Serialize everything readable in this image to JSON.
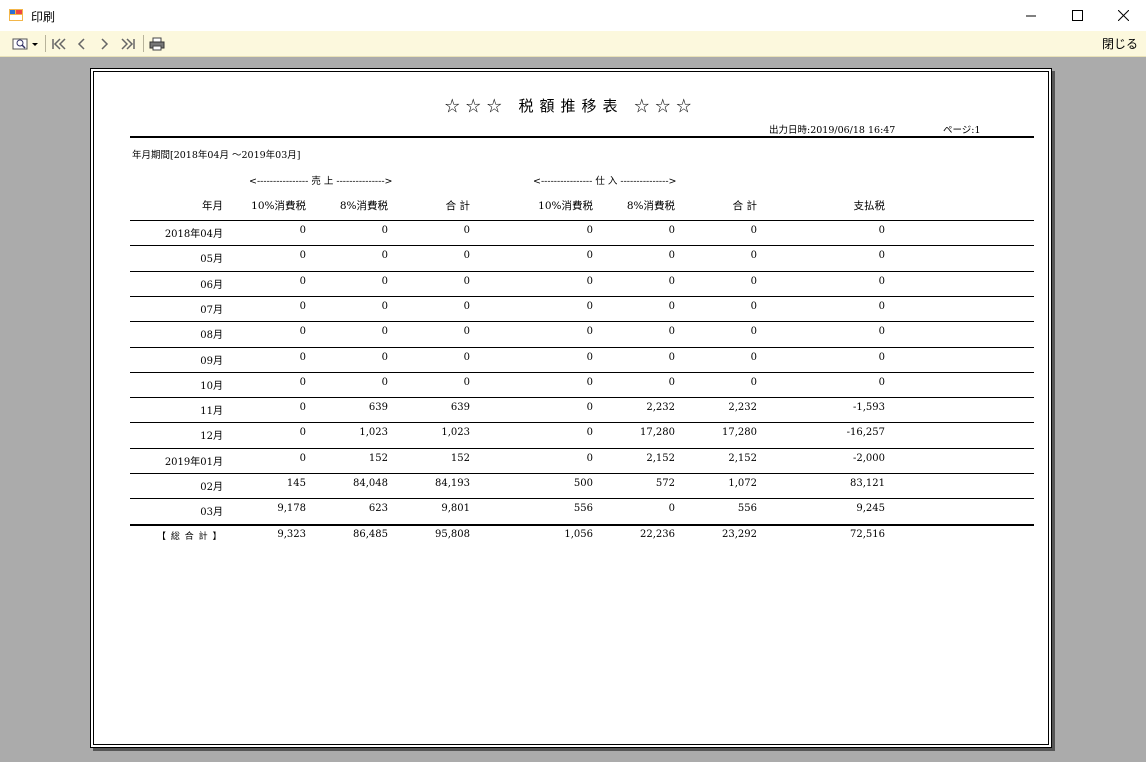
{
  "window": {
    "title": "印刷",
    "close_label": "閉じる"
  },
  "toolbar": {
    "icons": [
      "zoom-icon",
      "first-page-icon",
      "prev-page-icon",
      "next-page-icon",
      "last-page-icon",
      "print-icon"
    ]
  },
  "report": {
    "title": "☆☆☆ 税額推移表 ☆☆☆",
    "output_datetime": "出力日時:2019/06/18 16:47",
    "page": "ページ:1",
    "period": "年月期間[2018年04月 ～2019年03月]",
    "group_sales": "<---------------- 売  上 --------------->",
    "group_purchase": "<---------------- 仕  入 --------------->",
    "headers": [
      "年月",
      "10%消費税",
      "8%消費税",
      "合 計",
      "10%消費税",
      "8%消費税",
      "合 計",
      "支払税"
    ],
    "rows": [
      [
        "2018年04月",
        "0",
        "0",
        "0",
        "0",
        "0",
        "0",
        "0"
      ],
      [
        "05月",
        "0",
        "0",
        "0",
        "0",
        "0",
        "0",
        "0"
      ],
      [
        "06月",
        "0",
        "0",
        "0",
        "0",
        "0",
        "0",
        "0"
      ],
      [
        "07月",
        "0",
        "0",
        "0",
        "0",
        "0",
        "0",
        "0"
      ],
      [
        "08月",
        "0",
        "0",
        "0",
        "0",
        "0",
        "0",
        "0"
      ],
      [
        "09月",
        "0",
        "0",
        "0",
        "0",
        "0",
        "0",
        "0"
      ],
      [
        "10月",
        "0",
        "0",
        "0",
        "0",
        "0",
        "0",
        "0"
      ],
      [
        "11月",
        "0",
        "639",
        "639",
        "0",
        "2,232",
        "2,232",
        "-1,593"
      ],
      [
        "12月",
        "0",
        "1,023",
        "1,023",
        "0",
        "17,280",
        "17,280",
        "-16,257"
      ],
      [
        "2019年01月",
        "0",
        "152",
        "152",
        "0",
        "2,152",
        "2,152",
        "-2,000"
      ],
      [
        "02月",
        "145",
        "84,048",
        "84,193",
        "500",
        "572",
        "1,072",
        "83,121"
      ],
      [
        "03月",
        "9,178",
        "623",
        "9,801",
        "556",
        "0",
        "556",
        "9,245"
      ]
    ],
    "total": [
      "【 総 合 計 】",
      "9,323",
      "86,485",
      "95,808",
      "1,056",
      "22,236",
      "23,292",
      "72,516"
    ]
  }
}
